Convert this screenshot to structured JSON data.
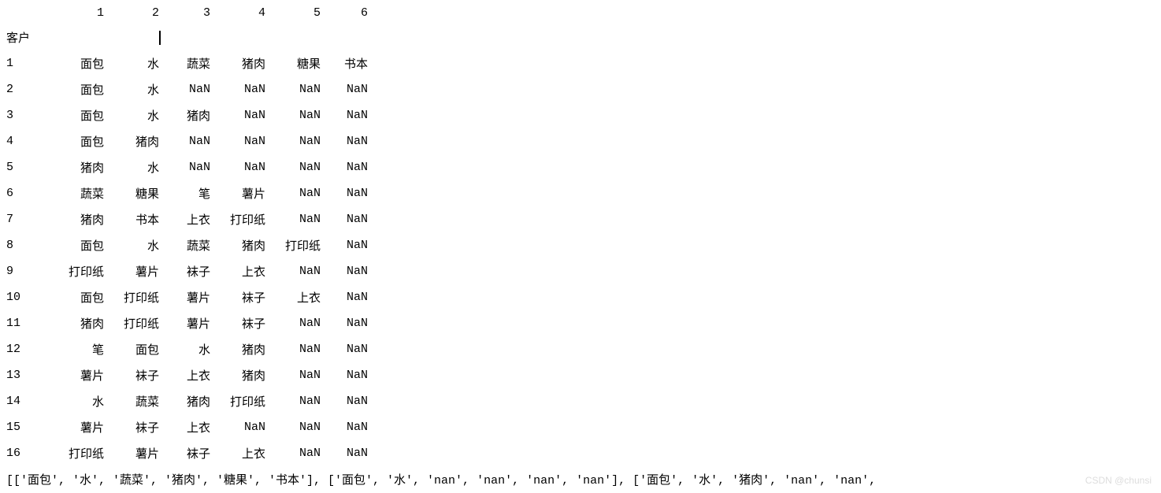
{
  "table": {
    "index_name": "客户",
    "columns": [
      "1",
      "2",
      "3",
      "4",
      "5",
      "6"
    ],
    "index": [
      "1",
      "2",
      "3",
      "4",
      "5",
      "6",
      "7",
      "8",
      "9",
      "10",
      "11",
      "12",
      "13",
      "14",
      "15",
      "16"
    ],
    "rows": [
      [
        "面包",
        "水",
        "蔬菜",
        "猪肉",
        "糖果",
        "书本"
      ],
      [
        "面包",
        "水",
        "NaN",
        "NaN",
        "NaN",
        "NaN"
      ],
      [
        "面包",
        "水",
        "猪肉",
        "NaN",
        "NaN",
        "NaN"
      ],
      [
        "面包",
        "猪肉",
        "NaN",
        "NaN",
        "NaN",
        "NaN"
      ],
      [
        "猪肉",
        "水",
        "NaN",
        "NaN",
        "NaN",
        "NaN"
      ],
      [
        "蔬菜",
        "糖果",
        "笔",
        "薯片",
        "NaN",
        "NaN"
      ],
      [
        "猪肉",
        "书本",
        "上衣",
        "打印纸",
        "NaN",
        "NaN"
      ],
      [
        "面包",
        "水",
        "蔬菜",
        "猪肉",
        "打印纸",
        "NaN"
      ],
      [
        "打印纸",
        "薯片",
        "袜子",
        "上衣",
        "NaN",
        "NaN"
      ],
      [
        "面包",
        "打印纸",
        "薯片",
        "袜子",
        "上衣",
        "NaN"
      ],
      [
        "猪肉",
        "打印纸",
        "薯片",
        "袜子",
        "NaN",
        "NaN"
      ],
      [
        "笔",
        "面包",
        "水",
        "猪肉",
        "NaN",
        "NaN"
      ],
      [
        "薯片",
        "袜子",
        "上衣",
        "猪肉",
        "NaN",
        "NaN"
      ],
      [
        "水",
        "蔬菜",
        "猪肉",
        "打印纸",
        "NaN",
        "NaN"
      ],
      [
        "薯片",
        "袜子",
        "上衣",
        "NaN",
        "NaN",
        "NaN"
      ],
      [
        "打印纸",
        "薯片",
        "袜子",
        "上衣",
        "NaN",
        "NaN"
      ]
    ]
  },
  "list_repr": "[['面包', '水', '蔬菜', '猪肉', '糖果', '书本'], ['面包', '水', 'nan', 'nan', 'nan', 'nan'], ['面包', '水', '猪肉', 'nan', 'nan',",
  "watermark": "CSDN @chunsi"
}
